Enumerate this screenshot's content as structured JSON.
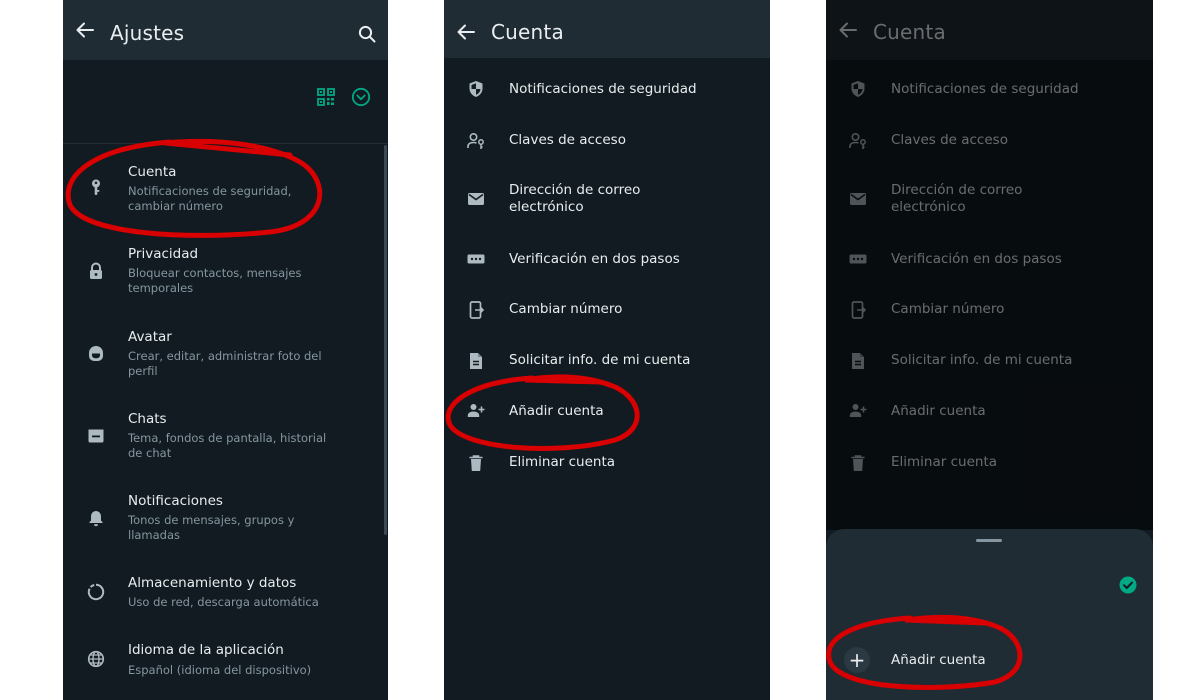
{
  "colors": {
    "panel_bg": "#111b21",
    "appbar_bg": "#1f2c34",
    "text_primary": "#e9edef",
    "text_secondary": "#8696a0",
    "accent_green": "#00a884",
    "annotation_red": "#d80000"
  },
  "settings_panel": {
    "title": "Ajustes",
    "items": [
      {
        "icon": "key-icon",
        "title": "Cuenta",
        "subtitle": "Notificaciones de seguridad, cambiar número"
      },
      {
        "icon": "lock-icon",
        "title": "Privacidad",
        "subtitle": "Bloquear contactos, mensajes temporales"
      },
      {
        "icon": "avatar-icon",
        "title": "Avatar",
        "subtitle": "Crear, editar, administrar foto del perfil"
      },
      {
        "icon": "chat-icon",
        "title": "Chats",
        "subtitle": "Tema, fondos de pantalla, historial de chat"
      },
      {
        "icon": "bell-icon",
        "title": "Notificaciones",
        "subtitle": "Tonos de mensajes, grupos y llamadas"
      },
      {
        "icon": "storage-icon",
        "title": "Almacenamiento y datos",
        "subtitle": "Uso de red, descarga automática"
      },
      {
        "icon": "globe-icon",
        "title": "Idioma de la aplicación",
        "subtitle": "Español (idioma del dispositivo)"
      }
    ]
  },
  "account_panel": {
    "title": "Cuenta",
    "items": [
      {
        "icon": "shield-icon",
        "title": "Notificaciones de seguridad"
      },
      {
        "icon": "passkey-icon",
        "title": "Claves de acceso"
      },
      {
        "icon": "mail-icon",
        "title": "Dirección de correo electrónico"
      },
      {
        "icon": "dots-icon",
        "title": "Verificación en dos pasos"
      },
      {
        "icon": "phone-change-icon",
        "title": "Cambiar número"
      },
      {
        "icon": "document-icon",
        "title": "Solicitar info. de mi cuenta"
      },
      {
        "icon": "add-person-icon",
        "title": "Añadir cuenta"
      },
      {
        "icon": "trash-icon",
        "title": "Eliminar cuenta"
      }
    ]
  },
  "account_panel_dimmed": {
    "title": "Cuenta",
    "items": [
      {
        "icon": "shield-icon",
        "title": "Notificaciones de seguridad"
      },
      {
        "icon": "passkey-icon",
        "title": "Claves de acceso"
      },
      {
        "icon": "mail-icon",
        "title": "Dirección de correo electrónico"
      },
      {
        "icon": "dots-icon",
        "title": "Verificación en dos pasos"
      },
      {
        "icon": "phone-change-icon",
        "title": "Cambiar número"
      },
      {
        "icon": "document-icon",
        "title": "Solicitar info. de mi cuenta"
      },
      {
        "icon": "add-person-icon",
        "title": "Añadir cuenta"
      },
      {
        "icon": "trash-icon",
        "title": "Eliminar cuenta"
      }
    ],
    "sheet": {
      "add_account_label": "Añadir cuenta"
    }
  }
}
